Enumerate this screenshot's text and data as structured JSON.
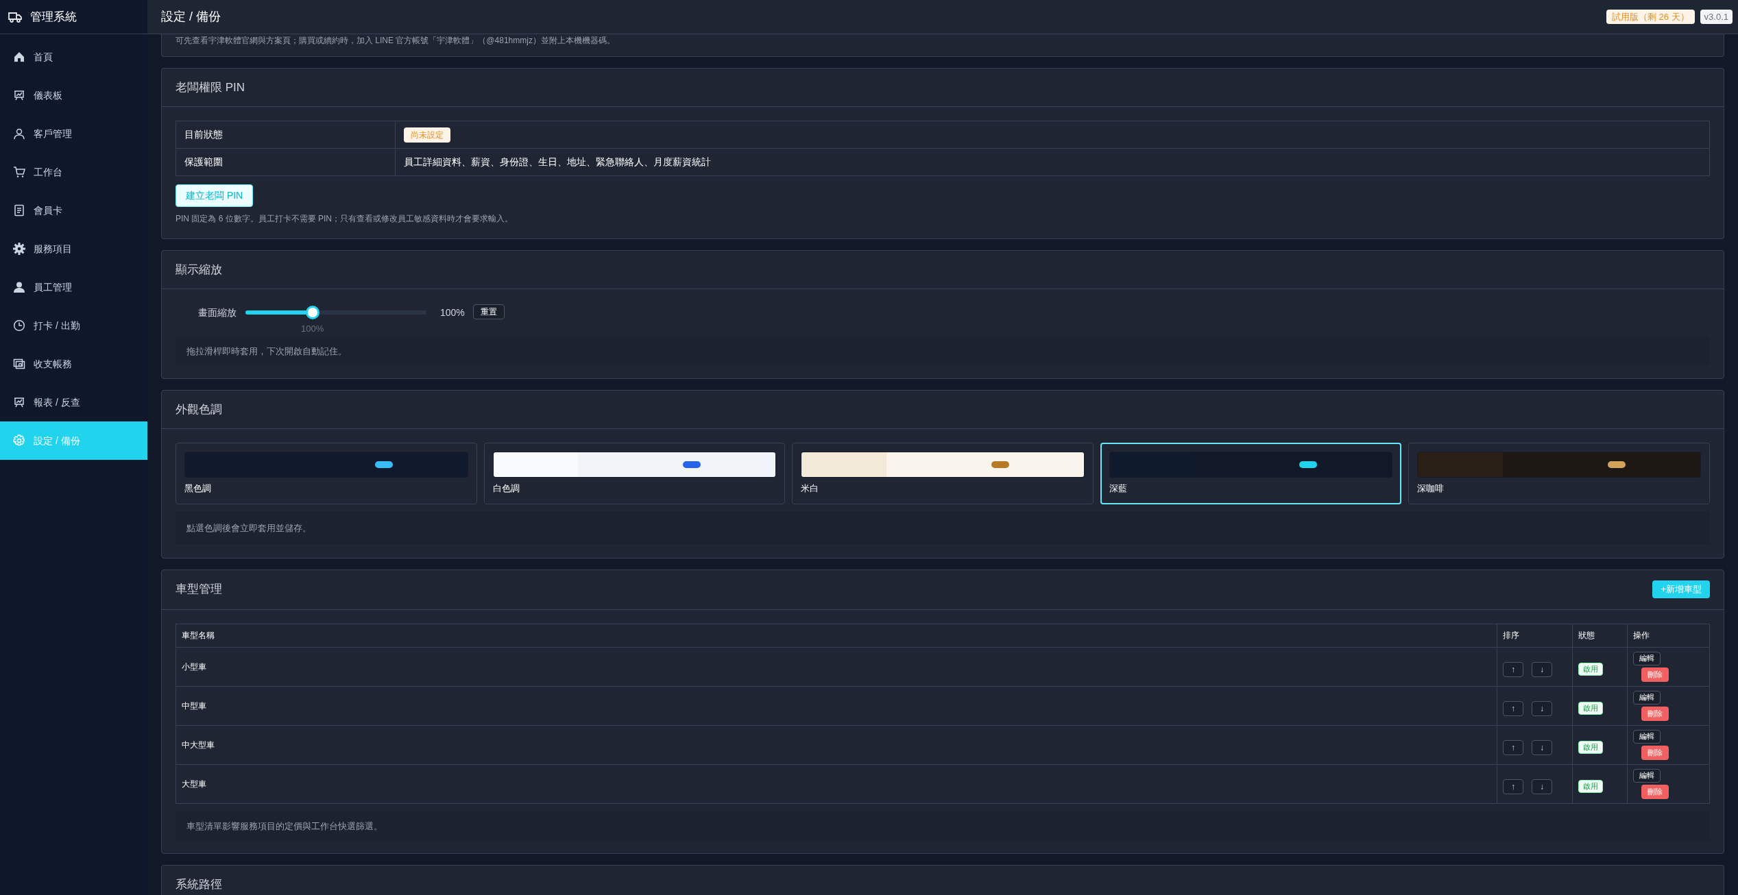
{
  "sidebar": {
    "title": "管理系統",
    "items": [
      {
        "label": "首頁",
        "selected": false
      },
      {
        "label": "儀表板",
        "selected": false
      },
      {
        "label": "客戶管理",
        "selected": false
      },
      {
        "label": "工作台",
        "selected": false
      },
      {
        "label": "會員卡",
        "selected": false
      },
      {
        "label": "服務項目",
        "selected": false
      },
      {
        "label": "員工管理",
        "selected": false
      },
      {
        "label": "打卡 / 出勤",
        "selected": false
      },
      {
        "label": "收支帳務",
        "selected": false
      },
      {
        "label": "報表 / 反查",
        "selected": false
      },
      {
        "label": "設定 / 備份",
        "selected": true
      }
    ]
  },
  "header": {
    "title": "設定 / 備份",
    "trial_badge": "試用版（剩 26 天）",
    "version": "v3.0.1"
  },
  "license_note": "可先查看宇津軟體官網與方案頁；購買或續約時，加入 LINE 官方帳號「宇津軟體」（@481hmmjz）並附上本機機器碼。",
  "pin": {
    "title": "老闆權限 PIN",
    "rows": [
      {
        "label": "目前狀態",
        "value": "尚未設定",
        "kind": "badge"
      },
      {
        "label": "保護範圍",
        "value": "員工詳細資料、薪資、身份證、生日、地址、緊急聯絡人、月度薪資統計",
        "kind": "text"
      }
    ],
    "button": "建立老闆 PIN",
    "note": "PIN 固定為 6 位數字。員工打卡不需要 PIN；只有查看或修改員工敏感資料時才會要求輸入。"
  },
  "zoom": {
    "title": "顯示縮放",
    "label": "畫面縮放",
    "level": 0.37,
    "reading": "100%",
    "thumb_reading": "100%",
    "reset": "重置",
    "note": "拖拉滑桿即時套用，下次開啟自動記住。"
  },
  "themes": {
    "title": "外觀色調",
    "items": [
      {
        "name": "黑色調",
        "selected": false,
        "color": "#38bdf8"
      },
      {
        "name": "白色調",
        "selected": false,
        "color": "#2563eb"
      },
      {
        "name": "米白",
        "selected": false,
        "color": "#b87a24"
      },
      {
        "name": "深藍",
        "selected": true,
        "color": "#22d3ee"
      },
      {
        "name": "深咖啡",
        "selected": false,
        "color": "#d4a35a"
      }
    ],
    "note": "點選色調後會立即套用並儲存。"
  },
  "vehicles": {
    "title": "車型管理",
    "add_button": "+新增車型",
    "columns": [
      "車型名稱",
      "排序",
      "狀態",
      "操作"
    ],
    "rows": [
      {
        "name": "小型車",
        "up": "↑",
        "down": "↓",
        "status": "啟用",
        "edit": "編輯",
        "delete": "刪除"
      },
      {
        "name": "中型車",
        "up": "↑",
        "down": "↓",
        "status": "啟用",
        "edit": "編輯",
        "delete": "刪除"
      },
      {
        "name": "中大型車",
        "up": "↑",
        "down": "↓",
        "status": "啟用",
        "edit": "編輯",
        "delete": "刪除"
      },
      {
        "name": "大型車",
        "up": "↑",
        "down": "↓",
        "status": "啟用",
        "edit": "編輯",
        "delete": "刪除"
      }
    ],
    "note": "車型清單影響服務項目的定價與工作台快選篩選。"
  },
  "paths": {
    "title": "系統路徑"
  }
}
